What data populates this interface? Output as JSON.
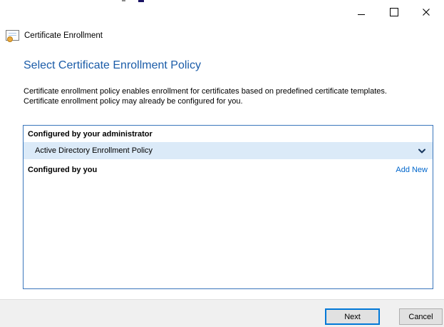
{
  "colors": {
    "heading": "#1b5ca8",
    "panel_border": "#3a76bb",
    "highlight_row": "#dbeaf8",
    "link": "#0066cc",
    "footer_bg": "#f0f0f0",
    "footer_divider": "#dfdfdf",
    "button_bg": "#e1e1e1",
    "next_border": "#0078d7",
    "cancel_border": "#adadad",
    "chevron": "#17365d"
  },
  "icons": {
    "app_icon": "certificate-icon",
    "minimize": "–",
    "maximize": "□",
    "close": "✕",
    "policy_expander": "chevron-down"
  },
  "header": {
    "app_title": "Certificate Enrollment"
  },
  "page": {
    "title": "Select Certificate Enrollment Policy",
    "description_line1": "Certificate enrollment policy enables enrollment for certificates based on predefined certificate templates.",
    "description_line2": "Certificate enrollment policy may already be configured for you."
  },
  "policy_panel": {
    "admin_section_label": "Configured by your administrator",
    "admin_policy_name": "Active Directory Enrollment Policy",
    "user_section_label": "Configured by you",
    "add_new_label": "Add New"
  },
  "footer": {
    "next_label": "Next",
    "cancel_label": "Cancel"
  }
}
